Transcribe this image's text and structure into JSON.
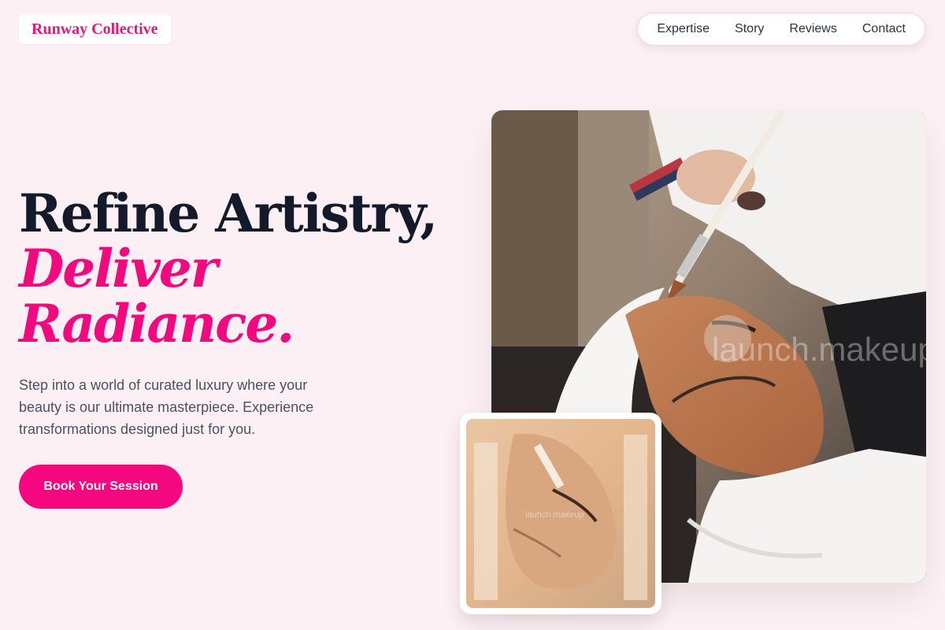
{
  "brand": {
    "name": "Runway Collective"
  },
  "nav": {
    "items": [
      {
        "label": "Expertise"
      },
      {
        "label": "Story"
      },
      {
        "label": "Reviews"
      },
      {
        "label": "Contact"
      }
    ]
  },
  "hero": {
    "line1": "Refine Artistry,",
    "line2": "Deliver",
    "line3": "Radiance.",
    "subtext": "Step into a world of curated luxury where your beauty is our ultimate masterpiece. Experience transformations designed just for you.",
    "cta_label": "Book Your Session"
  },
  "images": {
    "main": {
      "watermark": "launch.makeup"
    },
    "thumb": {
      "watermark": "launch.makeup"
    }
  },
  "colors": {
    "accent": "#f2087f",
    "background": "#fdf0f4",
    "heading": "#121a2c",
    "body": "#4b5161"
  }
}
